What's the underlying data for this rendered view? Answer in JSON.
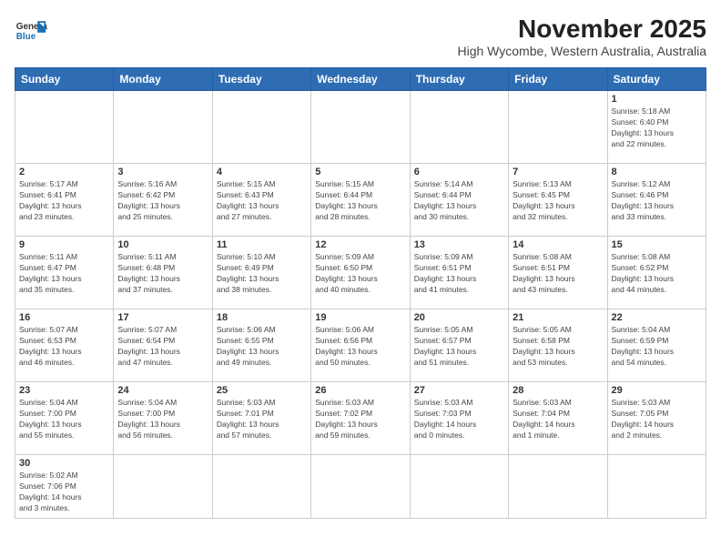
{
  "logo": {
    "line1": "General",
    "line2": "Blue"
  },
  "title": "November 2025",
  "subtitle": "High Wycombe, Western Australia, Australia",
  "weekdays": [
    "Sunday",
    "Monday",
    "Tuesday",
    "Wednesday",
    "Thursday",
    "Friday",
    "Saturday"
  ],
  "weeks": [
    [
      {
        "day": "",
        "info": ""
      },
      {
        "day": "",
        "info": ""
      },
      {
        "day": "",
        "info": ""
      },
      {
        "day": "",
        "info": ""
      },
      {
        "day": "",
        "info": ""
      },
      {
        "day": "",
        "info": ""
      },
      {
        "day": "1",
        "info": "Sunrise: 5:18 AM\nSunset: 6:40 PM\nDaylight: 13 hours\nand 22 minutes."
      }
    ],
    [
      {
        "day": "2",
        "info": "Sunrise: 5:17 AM\nSunset: 6:41 PM\nDaylight: 13 hours\nand 23 minutes."
      },
      {
        "day": "3",
        "info": "Sunrise: 5:16 AM\nSunset: 6:42 PM\nDaylight: 13 hours\nand 25 minutes."
      },
      {
        "day": "4",
        "info": "Sunrise: 5:15 AM\nSunset: 6:43 PM\nDaylight: 13 hours\nand 27 minutes."
      },
      {
        "day": "5",
        "info": "Sunrise: 5:15 AM\nSunset: 6:44 PM\nDaylight: 13 hours\nand 28 minutes."
      },
      {
        "day": "6",
        "info": "Sunrise: 5:14 AM\nSunset: 6:44 PM\nDaylight: 13 hours\nand 30 minutes."
      },
      {
        "day": "7",
        "info": "Sunrise: 5:13 AM\nSunset: 6:45 PM\nDaylight: 13 hours\nand 32 minutes."
      },
      {
        "day": "8",
        "info": "Sunrise: 5:12 AM\nSunset: 6:46 PM\nDaylight: 13 hours\nand 33 minutes."
      }
    ],
    [
      {
        "day": "9",
        "info": "Sunrise: 5:11 AM\nSunset: 6:47 PM\nDaylight: 13 hours\nand 35 minutes."
      },
      {
        "day": "10",
        "info": "Sunrise: 5:11 AM\nSunset: 6:48 PM\nDaylight: 13 hours\nand 37 minutes."
      },
      {
        "day": "11",
        "info": "Sunrise: 5:10 AM\nSunset: 6:49 PM\nDaylight: 13 hours\nand 38 minutes."
      },
      {
        "day": "12",
        "info": "Sunrise: 5:09 AM\nSunset: 6:50 PM\nDaylight: 13 hours\nand 40 minutes."
      },
      {
        "day": "13",
        "info": "Sunrise: 5:09 AM\nSunset: 6:51 PM\nDaylight: 13 hours\nand 41 minutes."
      },
      {
        "day": "14",
        "info": "Sunrise: 5:08 AM\nSunset: 6:51 PM\nDaylight: 13 hours\nand 43 minutes."
      },
      {
        "day": "15",
        "info": "Sunrise: 5:08 AM\nSunset: 6:52 PM\nDaylight: 13 hours\nand 44 minutes."
      }
    ],
    [
      {
        "day": "16",
        "info": "Sunrise: 5:07 AM\nSunset: 6:53 PM\nDaylight: 13 hours\nand 46 minutes."
      },
      {
        "day": "17",
        "info": "Sunrise: 5:07 AM\nSunset: 6:54 PM\nDaylight: 13 hours\nand 47 minutes."
      },
      {
        "day": "18",
        "info": "Sunrise: 5:06 AM\nSunset: 6:55 PM\nDaylight: 13 hours\nand 49 minutes."
      },
      {
        "day": "19",
        "info": "Sunrise: 5:06 AM\nSunset: 6:56 PM\nDaylight: 13 hours\nand 50 minutes."
      },
      {
        "day": "20",
        "info": "Sunrise: 5:05 AM\nSunset: 6:57 PM\nDaylight: 13 hours\nand 51 minutes."
      },
      {
        "day": "21",
        "info": "Sunrise: 5:05 AM\nSunset: 6:58 PM\nDaylight: 13 hours\nand 53 minutes."
      },
      {
        "day": "22",
        "info": "Sunrise: 5:04 AM\nSunset: 6:59 PM\nDaylight: 13 hours\nand 54 minutes."
      }
    ],
    [
      {
        "day": "23",
        "info": "Sunrise: 5:04 AM\nSunset: 7:00 PM\nDaylight: 13 hours\nand 55 minutes."
      },
      {
        "day": "24",
        "info": "Sunrise: 5:04 AM\nSunset: 7:00 PM\nDaylight: 13 hours\nand 56 minutes."
      },
      {
        "day": "25",
        "info": "Sunrise: 5:03 AM\nSunset: 7:01 PM\nDaylight: 13 hours\nand 57 minutes."
      },
      {
        "day": "26",
        "info": "Sunrise: 5:03 AM\nSunset: 7:02 PM\nDaylight: 13 hours\nand 59 minutes."
      },
      {
        "day": "27",
        "info": "Sunrise: 5:03 AM\nSunset: 7:03 PM\nDaylight: 14 hours\nand 0 minutes."
      },
      {
        "day": "28",
        "info": "Sunrise: 5:03 AM\nSunset: 7:04 PM\nDaylight: 14 hours\nand 1 minute."
      },
      {
        "day": "29",
        "info": "Sunrise: 5:03 AM\nSunset: 7:05 PM\nDaylight: 14 hours\nand 2 minutes."
      }
    ],
    [
      {
        "day": "30",
        "info": "Sunrise: 5:02 AM\nSunset: 7:06 PM\nDaylight: 14 hours\nand 3 minutes."
      },
      {
        "day": "",
        "info": ""
      },
      {
        "day": "",
        "info": ""
      },
      {
        "day": "",
        "info": ""
      },
      {
        "day": "",
        "info": ""
      },
      {
        "day": "",
        "info": ""
      },
      {
        "day": "",
        "info": ""
      }
    ]
  ]
}
